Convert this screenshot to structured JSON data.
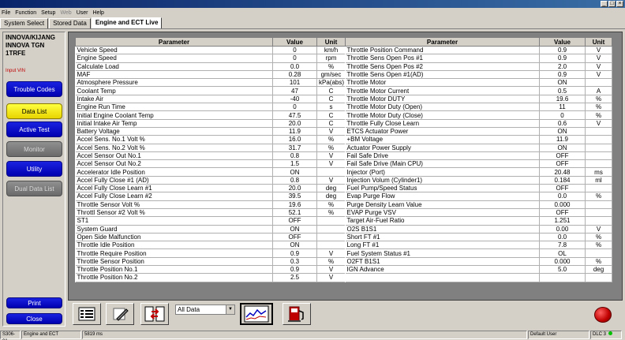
{
  "menu": [
    "File",
    "Function",
    "Setup",
    "Web",
    "User",
    "Help"
  ],
  "menu_disabled": [
    "Web"
  ],
  "tabs": [
    "System Select",
    "Stored Data",
    "Engine and ECT Live"
  ],
  "vehicle": [
    "INNOVA/KIJANG",
    "INNOVA TGN",
    "1TRFE"
  ],
  "input_vin": "Input VIN",
  "side_buttons": [
    {
      "label": "Trouble Codes",
      "style": "blue"
    },
    {
      "label": "Data List",
      "style": "yellow"
    },
    {
      "label": "Active Test",
      "style": "blue"
    },
    {
      "label": "Monitor",
      "style": "gray"
    },
    {
      "label": "Utility",
      "style": "blue"
    },
    {
      "label": "Dual Data List",
      "style": "gray"
    }
  ],
  "print_label": "Print",
  "close_label": "Close",
  "headers": [
    "Parameter",
    "Value",
    "Unit"
  ],
  "left_rows": [
    [
      "Vehicle Speed",
      "0",
      "km/h"
    ],
    [
      "Engine Speed",
      "0",
      "rpm"
    ],
    [
      "Calculate Load",
      "0.0",
      "%"
    ],
    [
      "MAF",
      "0.28",
      "gm/sec"
    ],
    [
      "Atmosphere Pressure",
      "101",
      "kPa(abs)"
    ],
    [
      "Coolant Temp",
      "47",
      "C"
    ],
    [
      "Intake Air",
      "-40",
      "C"
    ],
    [
      "Engine Run Time",
      "0",
      "s"
    ],
    [
      "Initial Engine Coolant Temp",
      "47.5",
      "C"
    ],
    [
      "Initial Intake Air Temp",
      "20.0",
      "C"
    ],
    [
      "Battery Voltage",
      "11.9",
      "V"
    ],
    [
      "Accel Sens. No.1 Volt %",
      "16.0",
      "%"
    ],
    [
      "Accel Sens. No.2 Volt %",
      "31.7",
      "%"
    ],
    [
      "Accel Sensor Out No.1",
      "0.8",
      "V"
    ],
    [
      "Accel Sensor Out No.2",
      "1.5",
      "V"
    ],
    [
      "Accelerator Idle Position",
      "ON",
      ""
    ],
    [
      "Accel Fully Close #1 (AD)",
      "0.8",
      "V"
    ],
    [
      "Accel Fully Close Learn #1",
      "20.0",
      "deg"
    ],
    [
      "Accel Fully Close Learn #2",
      "39.5",
      "deg"
    ],
    [
      "Throttle Sensor Volt %",
      "19.6",
      "%"
    ],
    [
      "Throttl Sensor #2 Volt %",
      "52.1",
      "%"
    ],
    [
      "ST1",
      "OFF",
      ""
    ],
    [
      "System Guard",
      "ON",
      ""
    ],
    [
      "Open Side Malfunction",
      "OFF",
      ""
    ],
    [
      "Throttle Idle Position",
      "ON",
      ""
    ],
    [
      "Throttle Require Position",
      "0.9",
      "V"
    ],
    [
      "Throttle Sensor Position",
      "0.3",
      "%"
    ],
    [
      "Throttle Position No.1",
      "0.9",
      "V"
    ],
    [
      "Throttle Position No.2",
      "2.5",
      "V"
    ]
  ],
  "right_rows": [
    [
      "Throttle Position Command",
      "0.9",
      "V"
    ],
    [
      "Throttle Sens Open Pos #1",
      "0.9",
      "V"
    ],
    [
      "Throttle Sens Open Pos #2",
      "2.0",
      "V"
    ],
    [
      "Throttle Sens Open #1(AD)",
      "0.9",
      "V"
    ],
    [
      "Throttle Motor",
      "ON",
      ""
    ],
    [
      "Throttle Motor Current",
      "0.5",
      "A"
    ],
    [
      "Throttle Motor DUTY",
      "19.6",
      "%"
    ],
    [
      "Throttle Motor Duty (Open)",
      "11",
      "%"
    ],
    [
      "Throttle Motor Duty (Close)",
      "0",
      "%"
    ],
    [
      "Throttle Fully Close Learn",
      "0.6",
      "V"
    ],
    [
      "ETCS Actuator Power",
      "ON",
      ""
    ],
    [
      "+BM Voltage",
      "11.9",
      ""
    ],
    [
      "Actuator Power Supply",
      "ON",
      ""
    ],
    [
      "Fail Safe Drive",
      "OFF",
      ""
    ],
    [
      "Fail Safe Drive (Main CPU)",
      "OFF",
      ""
    ],
    [
      "Injector (Port)",
      "20.48",
      "ms"
    ],
    [
      "Injection Volum (Cylinder1)",
      "0.184",
      "ml"
    ],
    [
      "Fuel Pump/Speed Status",
      "OFF",
      ""
    ],
    [
      "Evap Purge Flow",
      "0.0",
      "%"
    ],
    [
      "Purge Density Learn Value",
      "0.000",
      ""
    ],
    [
      "EVAP Purge VSV",
      "OFF",
      ""
    ],
    [
      "Target Air-Fuel Ratio",
      "1.251",
      ""
    ],
    [
      "O2S B1S1",
      "0.00",
      "V"
    ],
    [
      "Short FT #1",
      "0.0",
      "%"
    ],
    [
      "Long FT #1",
      "7.8",
      "%"
    ],
    [
      "Fuel System Status #1",
      "OL",
      ""
    ],
    [
      "O2FT B1S1",
      "0.000",
      "%"
    ],
    [
      "IGN Advance",
      "5.0",
      "deg"
    ],
    [
      "",
      "",
      ""
    ]
  ],
  "dropdown_value": "All Data",
  "status": {
    "code": "S306-01",
    "system": "Engine and ECT",
    "time": "5819 ms",
    "user": "Default User",
    "dlc": "DLC 3"
  }
}
